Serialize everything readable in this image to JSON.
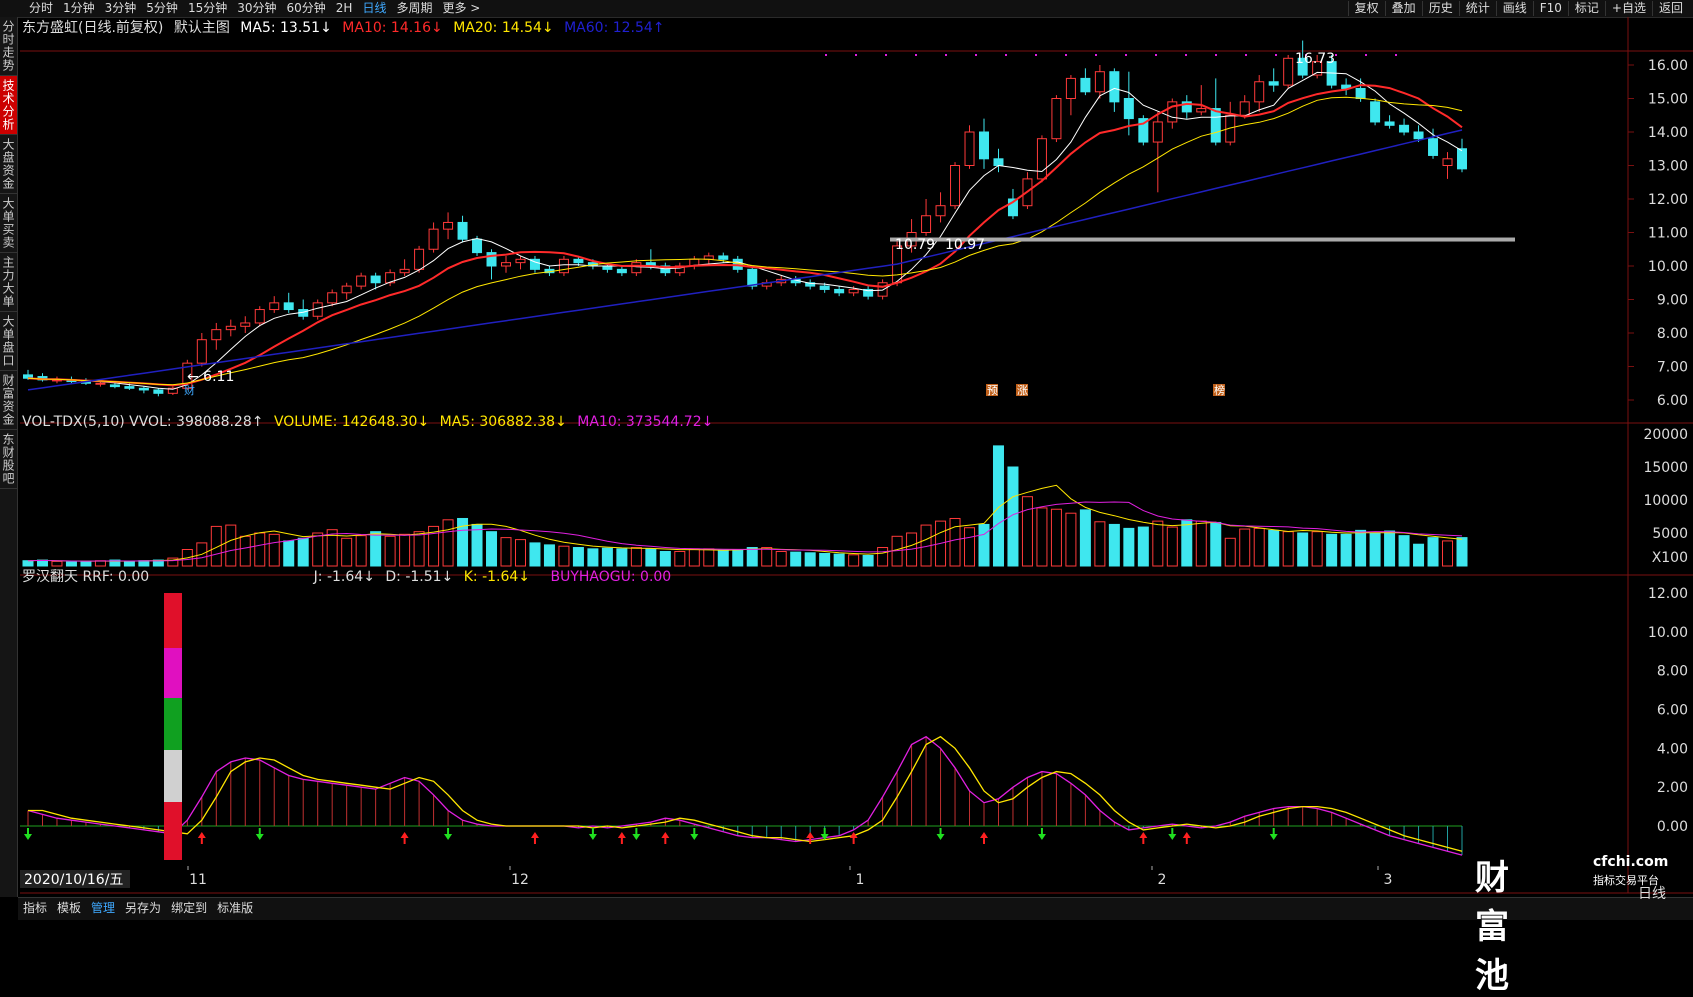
{
  "topbar": {
    "tabs": [
      "分时",
      "1分钟",
      "3分钟",
      "5分钟",
      "15分钟",
      "30分钟",
      "60分钟",
      "2H",
      "日线",
      "多周期",
      "更多 >"
    ],
    "active_tab": "日线",
    "right_items": [
      "复权",
      "叠加",
      "历史",
      "统计",
      "画线",
      "F10",
      "标记",
      "+自选",
      "返回"
    ]
  },
  "sidebar": {
    "items": [
      "分时走势",
      "技术分析",
      "大盘资金",
      "大单买卖",
      "主力大单",
      "大单盘口",
      "财富资金",
      "东财股吧"
    ],
    "active": "技术分析"
  },
  "main_header": {
    "stock": "东方盛虹(日线.前复权)",
    "template": "默认主图",
    "ma5": "MA5: 13.51↓",
    "ma10": "MA10: 14.16↓",
    "ma20": "MA20: 14.54↓",
    "ma60": "MA60: 12.54↑"
  },
  "vol_header": {
    "name": "VOL-TDX(5,10) VVOL: 398088.28↑",
    "volume": "VOLUME: 142648.30↓",
    "ma5": "MA5: 306882.38↓",
    "ma10": "MA10: 373544.72↓"
  },
  "ind_header": {
    "name": "罗汉翻天 RRF: 0.00",
    "j": "J: -1.64↓",
    "d": "D: -1.51↓",
    "k": "K: -1.64↓",
    "buy": "BUYHAOGU: 0.00"
  },
  "price_axis": [
    "16.00",
    "15.00",
    "14.00",
    "13.00",
    "12.00",
    "11.00",
    "10.00",
    "9.00",
    "8.00",
    "7.00",
    "6.00"
  ],
  "vol_axis": [
    "20000",
    "15000",
    "10000",
    "5000",
    "X100"
  ],
  "ind_axis": [
    "12.00",
    "10.00",
    "8.00",
    "6.00",
    "4.00",
    "2.00",
    "0.00"
  ],
  "annotations": {
    "high": "16.73",
    "low": "6.11",
    "label_a": "10.79",
    "label_b": "10.97",
    "tag_cai": "财",
    "tag_yu": "预",
    "tag_zhang": "涨",
    "tag_bang": "榜"
  },
  "date_axis": {
    "current_date": "2020/10/16/五",
    "months": [
      "11",
      "12",
      "1",
      "2",
      "3"
    ]
  },
  "bottom_tabs": [
    "指标",
    "模板",
    "管理",
    "另存为",
    "绑定到",
    "标准版"
  ],
  "bottom_active": "管理",
  "period_label": "日线",
  "logo": {
    "name": "财富池",
    "url": "cfchi.com",
    "subtitle": "指标交易平台"
  },
  "colors": {
    "up": "#ff3a3a",
    "down": "#3fe7ef",
    "ma5": "#ffffff",
    "ma10": "#ff2a2a",
    "ma20": "#ffe600",
    "ma60": "#2020c0",
    "magenta": "#e020e0"
  }
}
